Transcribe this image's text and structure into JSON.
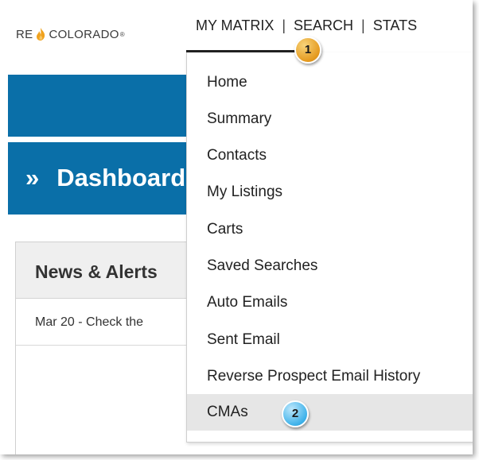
{
  "logo": {
    "text_left": "RE",
    "text_right": "COLORADO",
    "registered": "®",
    "flame_icon": "flame-icon",
    "flame_color": "#f0a21e"
  },
  "nav": {
    "items": [
      "MY MATRIX",
      "SEARCH",
      "STATS"
    ],
    "separator": "|"
  },
  "dashboard": {
    "chevron": "»",
    "title": "Dashboard"
  },
  "news": {
    "title": "News & Alerts",
    "first_item": "Mar 20 - Check the"
  },
  "menu": {
    "items": [
      "Home",
      "Summary",
      "Contacts",
      "My Listings",
      "Carts",
      "Saved Searches",
      "Auto Emails",
      "Sent Email",
      "Reverse Prospect Email History",
      "CMAs"
    ],
    "highlighted_index": 9
  },
  "callouts": {
    "first": "1",
    "second": "2"
  },
  "colors": {
    "brand_blue": "#0a6fa8",
    "highlight_gray": "#e6e6e6",
    "callout_orange": "#e59a1f",
    "callout_blue": "#3fb2ea"
  }
}
